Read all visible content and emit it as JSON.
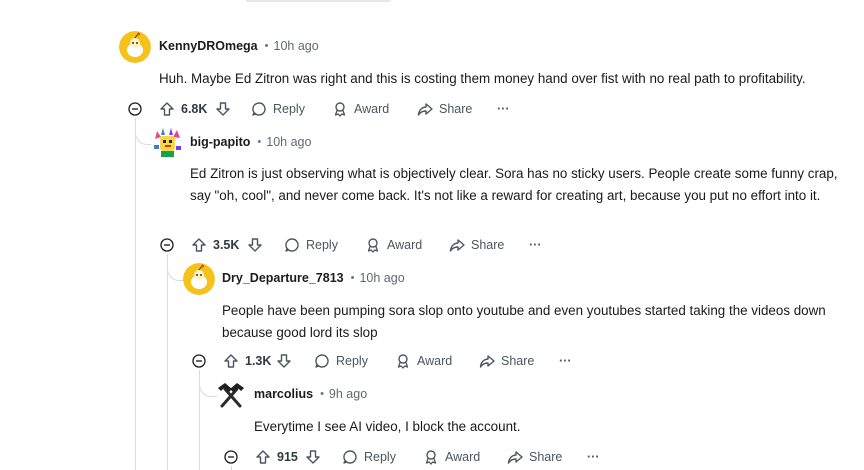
{
  "comments": [
    {
      "user": "KennyDROmega",
      "time": "10h ago",
      "body": "Huh. Maybe Ed Zitron was right and this is costing them money hand over fist with no real path to profitability.",
      "score": "6.8K",
      "reply": "Reply",
      "award": "Award",
      "share": "Share",
      "more": "···",
      "avatar_icon": "snoo-avatar-icon"
    },
    {
      "user": "big-papito",
      "time": "10h ago",
      "body": "Ed Zitron is just observing what is objectively clear. Sora has no sticky users. People create some funny crap, say \"oh, cool\", and never come back. It's not like a reward for creating art, because you put no effort into it.",
      "score": "3.5K",
      "reply": "Reply",
      "award": "Award",
      "share": "Share",
      "more": "···",
      "avatar_icon": "pixel-creature-avatar-icon"
    },
    {
      "user": "Dry_Departure_7813",
      "time": "10h ago",
      "body": "People have been pumping sora slop onto youtube and even youtubes started taking the videos down because good lord its slop",
      "score": "1.3K",
      "reply": "Reply",
      "award": "Award",
      "share": "Share",
      "more": "···",
      "avatar_icon": "snoo-avatar-icon"
    },
    {
      "user": "marcolius",
      "time": "9h ago",
      "body": "Everytime I see AI video, I block the account.",
      "score": "915",
      "reply": "Reply",
      "award": "Award",
      "share": "Share",
      "more": "···",
      "avatar_icon": "crossed-hammers-avatar-icon"
    }
  ],
  "dot": "•",
  "colors": {
    "text": "#1a1a1b",
    "meta": "#5c6b73",
    "rail": "#d7dadc",
    "snoo": "#f5c21b"
  }
}
